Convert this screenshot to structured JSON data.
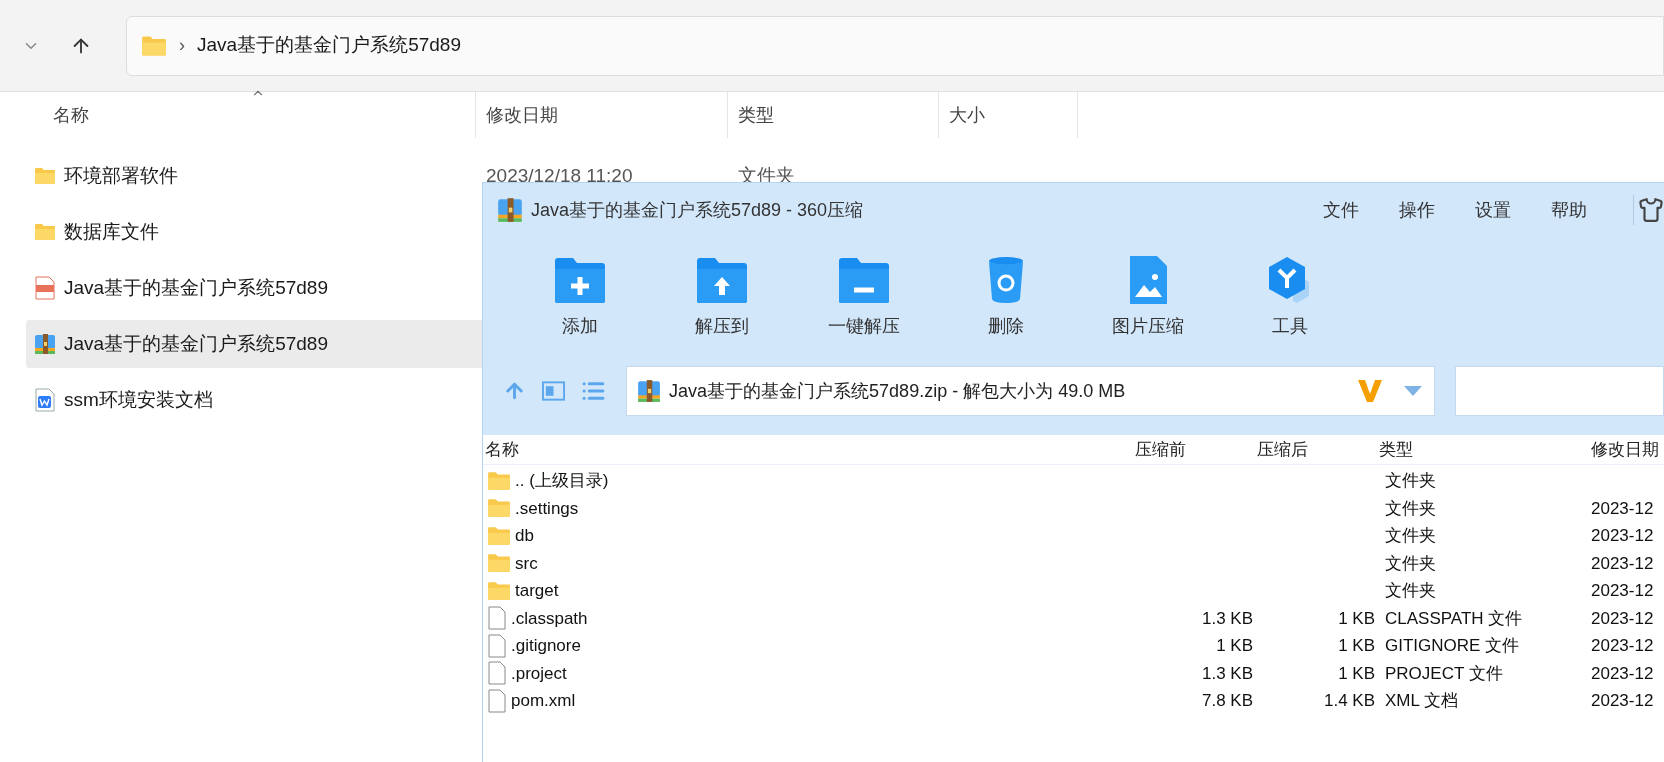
{
  "explorer": {
    "breadcrumb": "Java基于的基金门户系统57d89",
    "separator": "›",
    "columns": [
      "名称",
      "修改日期",
      "类型",
      "大小"
    ],
    "items": [
      {
        "kind": "folder",
        "name": "环境部署软件",
        "date": "2023/12/18 11:20",
        "type": "文件夹",
        "selected": false
      },
      {
        "kind": "folder",
        "name": "数据库文件",
        "selected": false
      },
      {
        "kind": "mp4",
        "name": "Java基于的基金门户系统57d89",
        "selected": false
      },
      {
        "kind": "zip",
        "name": "Java基于的基金门户系统57d89",
        "selected": true
      },
      {
        "kind": "doc",
        "name": "ssm环境安装文档",
        "selected": false
      }
    ]
  },
  "archiver": {
    "title": "Java基于的基金门户系统57d89 - 360压缩",
    "menu": [
      "文件",
      "操作",
      "设置",
      "帮助"
    ],
    "tools": [
      {
        "kind": "add",
        "label": "添加"
      },
      {
        "kind": "extract",
        "label": "解压到"
      },
      {
        "kind": "quick",
        "label": "一键解压"
      },
      {
        "kind": "delete",
        "label": "删除"
      },
      {
        "kind": "image",
        "label": "图片压缩"
      },
      {
        "kind": "tools",
        "label": "工具"
      }
    ],
    "path": "Java基于的基金门户系统57d89.zip - 解包大小为 49.0 MB",
    "columns": [
      "名称",
      "压缩前",
      "压缩后",
      "类型",
      "修改日期"
    ],
    "rows": [
      {
        "kind": "folder",
        "name": ".. (上级目录)",
        "type": "文件夹"
      },
      {
        "kind": "folder",
        "name": ".settings",
        "type": "文件夹",
        "date": "2023-12"
      },
      {
        "kind": "folder",
        "name": "db",
        "type": "文件夹",
        "date": "2023-12"
      },
      {
        "kind": "folder",
        "name": "src",
        "type": "文件夹",
        "date": "2023-12"
      },
      {
        "kind": "folder",
        "name": "target",
        "type": "文件夹",
        "date": "2023-12"
      },
      {
        "kind": "file",
        "name": ".classpath",
        "before": "1.3 KB",
        "after": "1 KB",
        "type": "CLASSPATH 文件",
        "date": "2023-12"
      },
      {
        "kind": "file",
        "name": ".gitignore",
        "before": "1 KB",
        "after": "1 KB",
        "type": "GITIGNORE 文件",
        "date": "2023-12"
      },
      {
        "kind": "file",
        "name": ".project",
        "before": "1.3 KB",
        "after": "1 KB",
        "type": "PROJECT 文件",
        "date": "2023-12"
      },
      {
        "kind": "file",
        "name": "pom.xml",
        "before": "7.8 KB",
        "after": "1.4 KB",
        "type": "XML 文档",
        "date": "2023-12"
      }
    ]
  }
}
